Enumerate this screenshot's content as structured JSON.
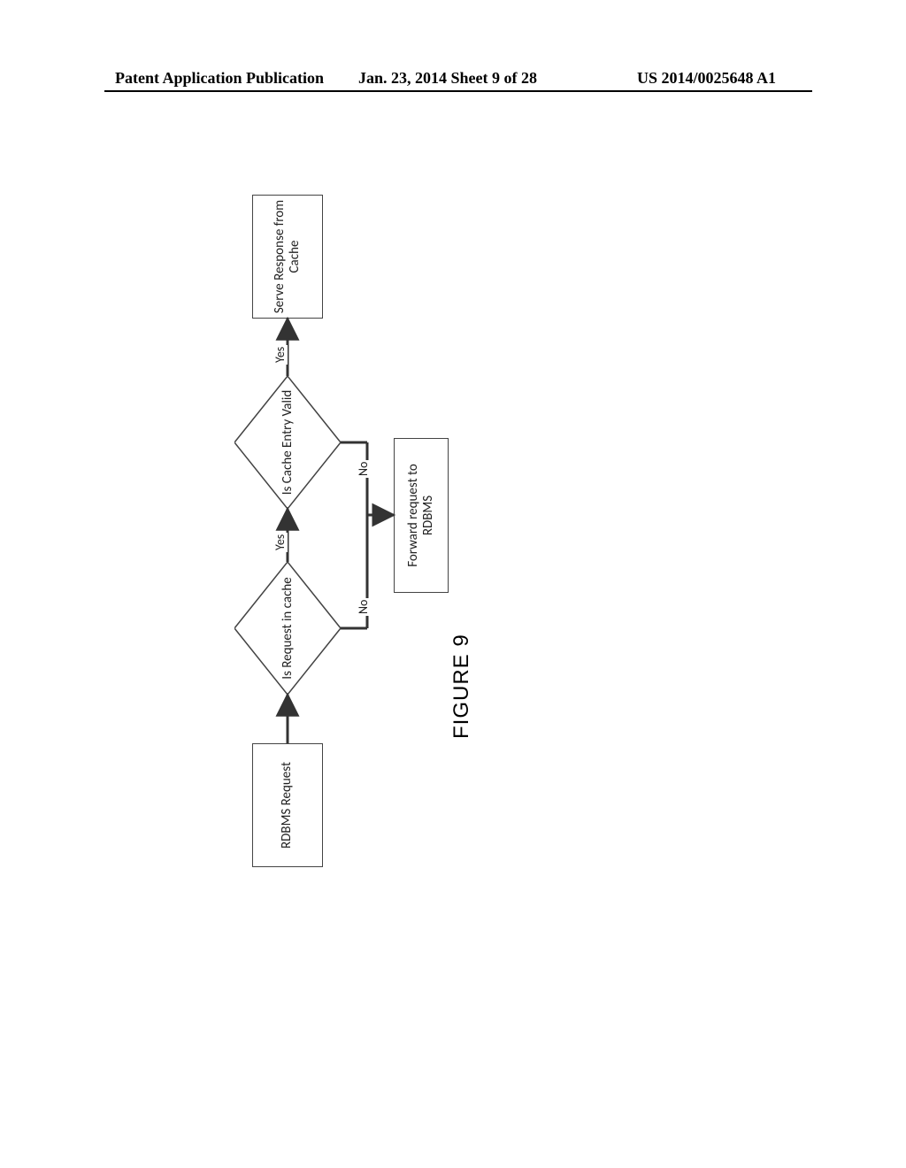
{
  "header": {
    "left": "Patent Application Publication",
    "center": "Jan. 23, 2014  Sheet 9 of 28",
    "right": "US 2014/0025648 A1"
  },
  "caption": "FIGURE 9",
  "flow": {
    "start": "RDBMS Request",
    "decision1": "Is Request in cache",
    "decision2": "Is Cache Entry Valid",
    "serve": "Serve Response from Cache",
    "forward": "Forward request to RDBMS",
    "yes1": "Yes",
    "yes2": "Yes",
    "no1": "No",
    "no2": "No"
  },
  "chart_data": {
    "type": "flowchart",
    "nodes": [
      {
        "id": "n1",
        "kind": "process",
        "text": "RDBMS Request"
      },
      {
        "id": "d1",
        "kind": "decision",
        "text": "Is Request in cache"
      },
      {
        "id": "d2",
        "kind": "decision",
        "text": "Is Cache Entry Valid"
      },
      {
        "id": "n2",
        "kind": "process",
        "text": "Serve Response from Cache"
      },
      {
        "id": "n3",
        "kind": "process",
        "text": "Forward request to RDBMS"
      }
    ],
    "edges": [
      {
        "from": "n1",
        "to": "d1",
        "label": ""
      },
      {
        "from": "d1",
        "to": "d2",
        "label": "Yes"
      },
      {
        "from": "d2",
        "to": "n2",
        "label": "Yes"
      },
      {
        "from": "d1",
        "to": "n3",
        "label": "No"
      },
      {
        "from": "d2",
        "to": "n3",
        "label": "No"
      }
    ]
  }
}
